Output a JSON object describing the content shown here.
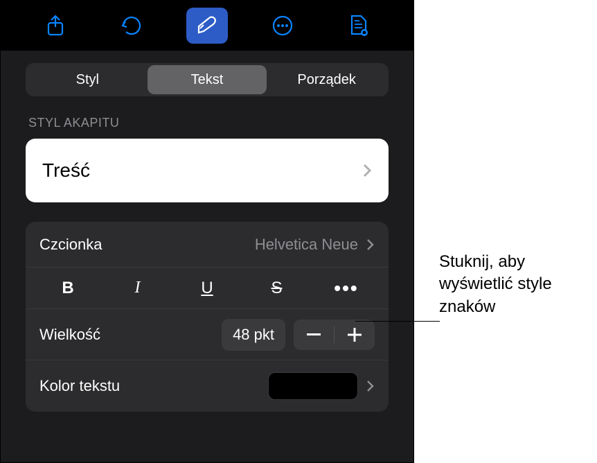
{
  "toolbar": {
    "icons": [
      "share-icon",
      "undo-icon",
      "format-brush-icon",
      "more-icon",
      "document-icon"
    ]
  },
  "tabs": {
    "items": [
      {
        "label": "Styl"
      },
      {
        "label": "Tekst"
      },
      {
        "label": "Porządek"
      }
    ],
    "active": 1
  },
  "paragraphStyle": {
    "sectionLabel": "STYL AKAPITU",
    "value": "Treść"
  },
  "font": {
    "label": "Czcionka",
    "value": "Helvetica Neue"
  },
  "formatButtons": {
    "bold": "B",
    "italic": "I",
    "underline": "U",
    "strike": "S",
    "more": "•••"
  },
  "size": {
    "label": "Wielkość",
    "value": "48 pkt"
  },
  "textColor": {
    "label": "Kolor tekstu",
    "swatch": "#000000"
  },
  "callout": {
    "text": "Stuknij, aby wyświetlić style znaków"
  }
}
